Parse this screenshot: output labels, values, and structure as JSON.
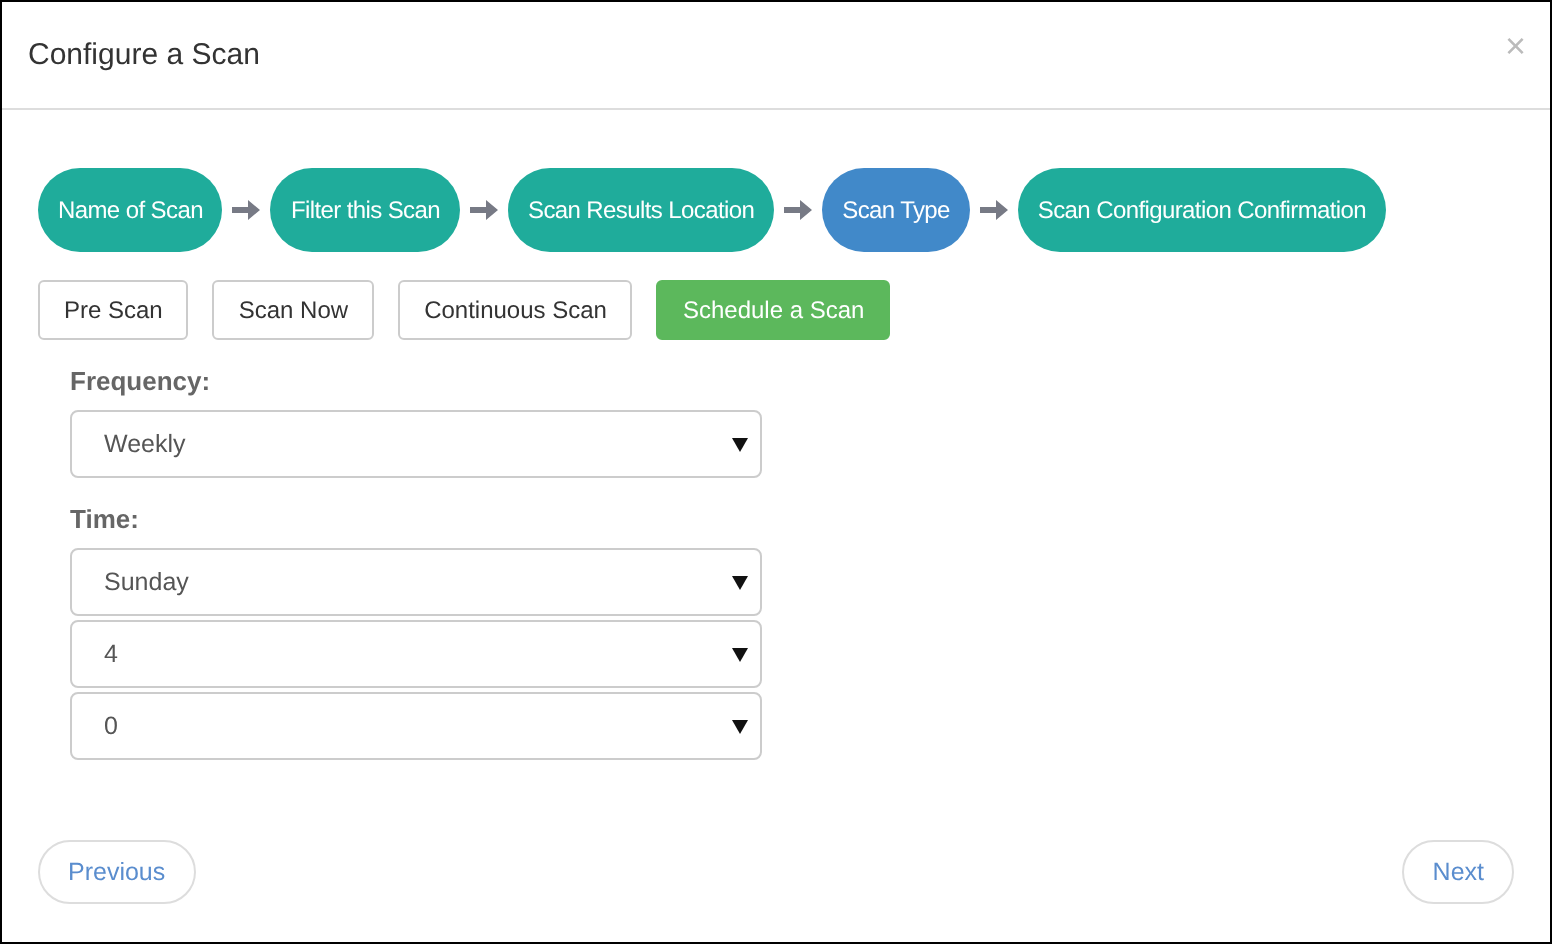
{
  "dialog": {
    "title": "Configure a Scan",
    "close": "×"
  },
  "steps": [
    {
      "label": "Name of Scan",
      "selected": false
    },
    {
      "label": "Filter this Scan",
      "selected": false
    },
    {
      "label": "Scan Results Location",
      "selected": false
    },
    {
      "label": "Scan Type",
      "selected": true
    },
    {
      "label": "Scan Configuration Confirmation",
      "selected": false
    }
  ],
  "scan_types": [
    {
      "label": "Pre Scan",
      "selected": false
    },
    {
      "label": "Scan Now",
      "selected": false
    },
    {
      "label": "Continuous Scan",
      "selected": false
    },
    {
      "label": "Schedule a Scan",
      "selected": true
    }
  ],
  "fields": [
    {
      "label": "Frequency:",
      "selects": [
        "Weekly"
      ]
    },
    {
      "label": "Time:",
      "selects": [
        "Sunday",
        "4",
        "0"
      ]
    }
  ],
  "footer": {
    "previous": "Previous",
    "next": "Next"
  }
}
